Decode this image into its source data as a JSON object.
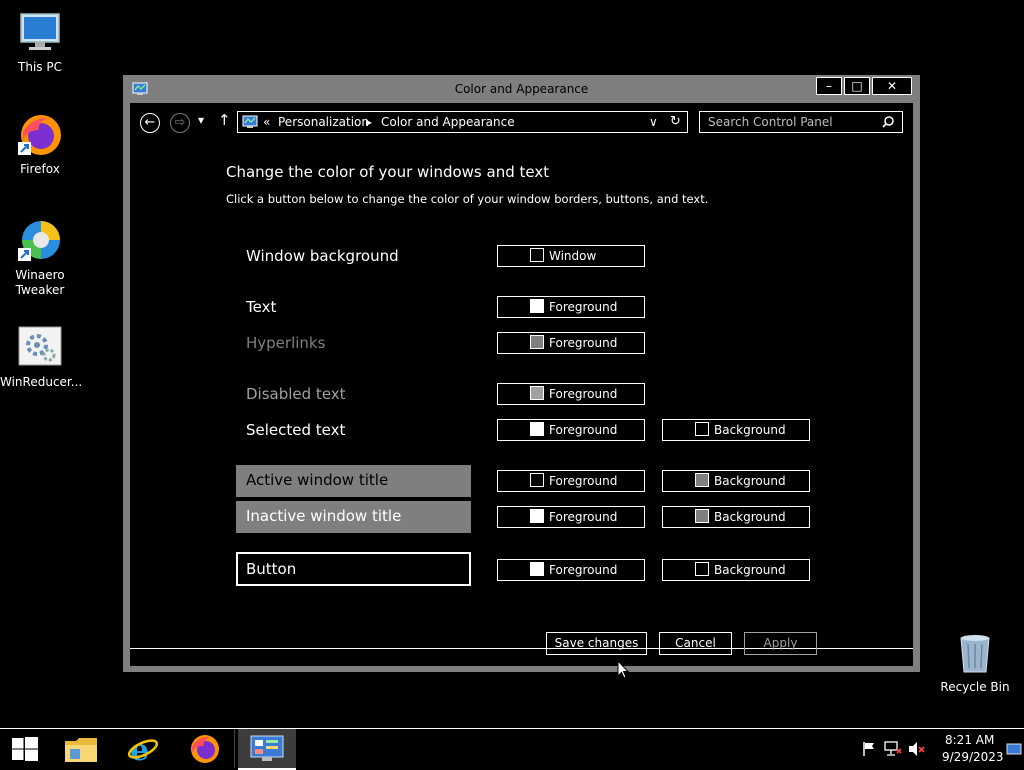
{
  "desktop": {
    "icons": [
      {
        "label": "This PC",
        "icon": "this-pc-icon"
      },
      {
        "label": "Firefox",
        "icon": "firefox-icon"
      },
      {
        "label": "Winaero Tweaker",
        "icon": "winaero-tweaker-icon"
      },
      {
        "label": "WinReducer...",
        "icon": "winreducer-icon"
      },
      {
        "label": "Recycle Bin",
        "icon": "recycle-bin-icon"
      }
    ]
  },
  "window": {
    "title": "Color and Appearance",
    "controls": {
      "minimize": "–",
      "maximize": "□",
      "close": "✕"
    },
    "nav": {
      "back": "←",
      "forward": "⇨",
      "recent": "▾",
      "up": "↑",
      "breadcrumb_prefix": "«",
      "breadcrumb": [
        "Personalization",
        "Color and Appearance"
      ],
      "separator": "▸",
      "dropdown": "∨",
      "refresh": "↻"
    },
    "search": {
      "placeholder": "Search Control Panel",
      "icon": "search-icon"
    },
    "heading": "Change the color of your windows and text",
    "subheading": "Click a button below to change the color of your window borders, buttons, and text.",
    "rows": [
      {
        "label": "Window background",
        "buttons": [
          {
            "text": "Window",
            "swatch": "#000000"
          }
        ]
      },
      {
        "label": "Text",
        "buttons": [
          {
            "text": "Foreground",
            "swatch": "#ffffff"
          }
        ]
      },
      {
        "label": "Hyperlinks",
        "buttons": [
          {
            "text": "Foreground",
            "swatch": "#808080"
          }
        ]
      },
      {
        "label": "Disabled text",
        "buttons": [
          {
            "text": "Foreground",
            "swatch": "#a0a0a0"
          }
        ]
      },
      {
        "label": "Selected text",
        "buttons": [
          {
            "text": "Foreground",
            "swatch": "#ffffff"
          },
          {
            "text": "Background",
            "swatch": "#000000"
          }
        ]
      },
      {
        "label": "Active window title",
        "buttons": [
          {
            "text": "Foreground",
            "swatch": "#000000"
          },
          {
            "text": "Background",
            "swatch": "#7f7f7f"
          }
        ]
      },
      {
        "label": "Inactive window title",
        "buttons": [
          {
            "text": "Foreground",
            "swatch": "#ffffff"
          },
          {
            "text": "Background",
            "swatch": "#7f7f7f"
          }
        ]
      },
      {
        "label": "Button",
        "buttons": [
          {
            "text": "Foreground",
            "swatch": "#ffffff"
          },
          {
            "text": "Background",
            "swatch": "#000000"
          }
        ]
      }
    ],
    "footer": {
      "save": "Save changes",
      "cancel": "Cancel",
      "apply": "Apply"
    }
  },
  "taskbar": {
    "items": [
      "start-icon",
      "file-explorer-icon",
      "internet-explorer-icon",
      "firefox-icon",
      "control-panel-icon"
    ],
    "clock": {
      "time": "8:21 AM",
      "date": "9/29/2023"
    }
  },
  "colors": {
    "window_frame": "#7f7f7f",
    "background": "#000000",
    "text": "#ffffff",
    "hyperlink": "#808080",
    "disabled": "#a0a0a0"
  }
}
